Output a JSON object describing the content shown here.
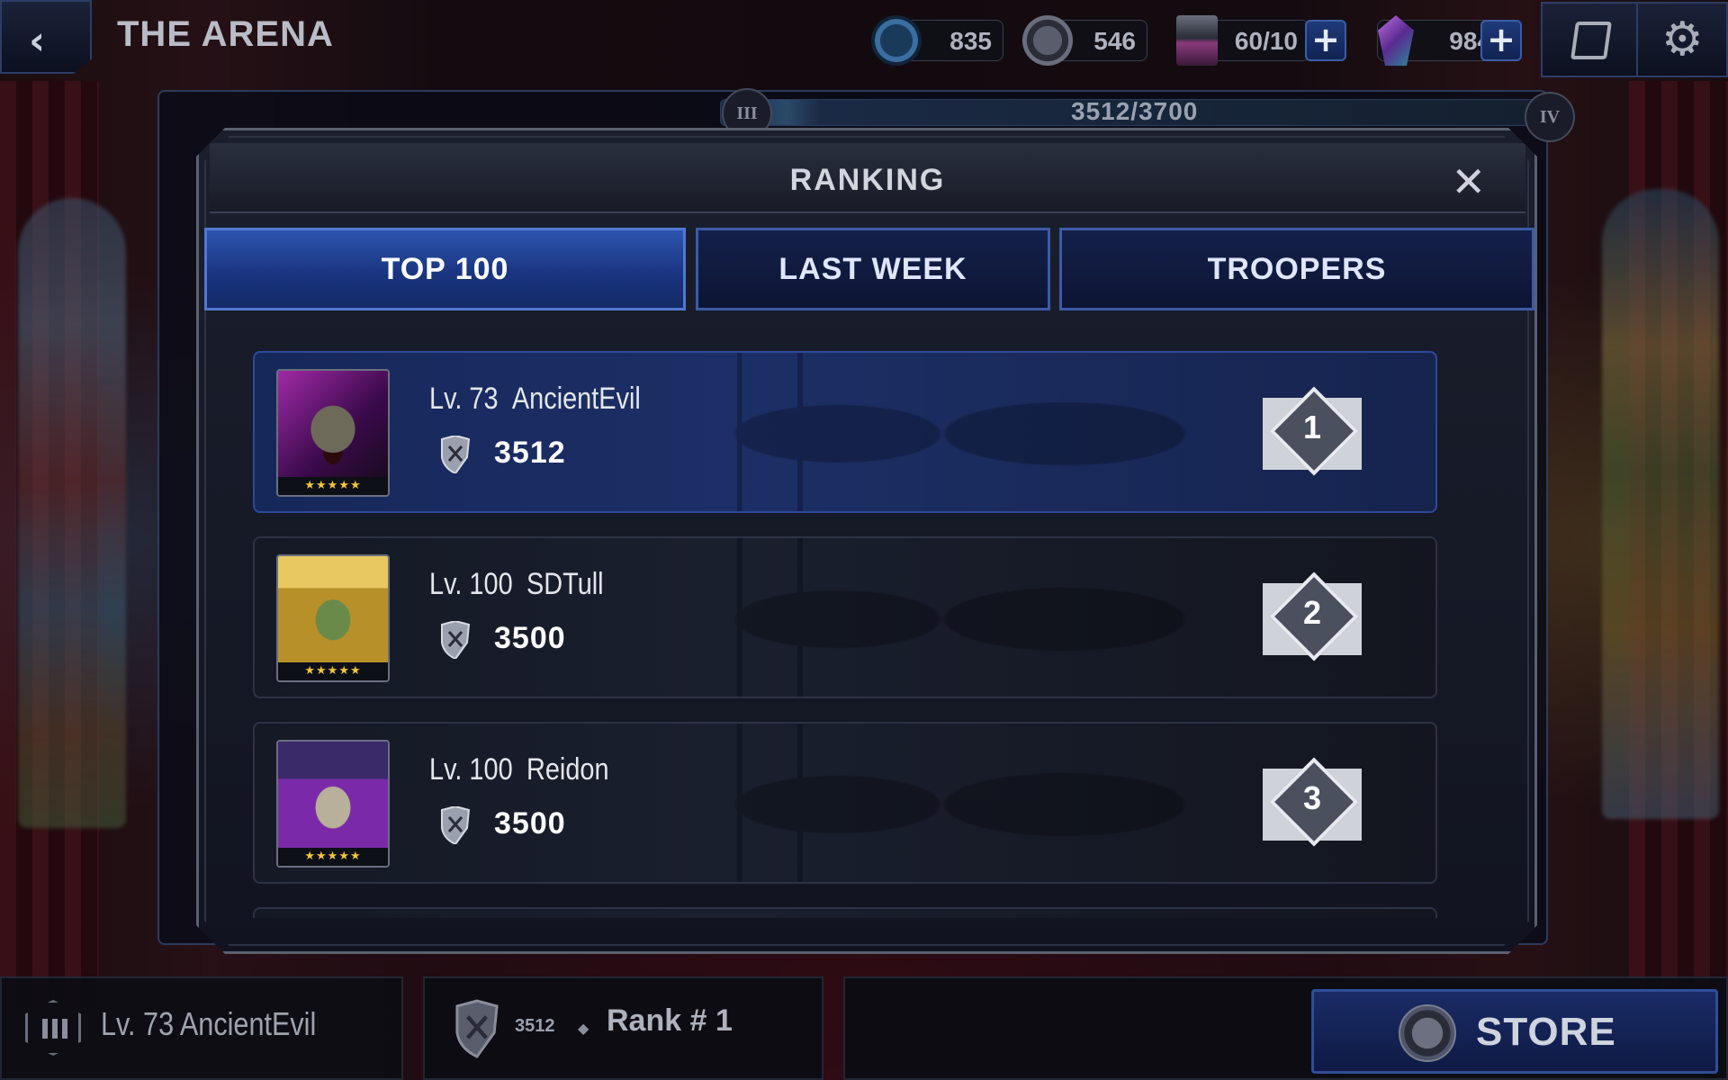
{
  "header": {
    "title": "THE ARENA",
    "resources": [
      {
        "name": "arena-token",
        "value": "835"
      },
      {
        "name": "trooper-coin",
        "value": "546"
      },
      {
        "name": "stamina",
        "value": "60/10"
      },
      {
        "name": "crystals",
        "value": "984"
      }
    ]
  },
  "background": {
    "progress_text": "3512/3700",
    "badge_left": "III",
    "badge_right": "IV"
  },
  "modal": {
    "title": "RANKING",
    "close_glyph": "✕",
    "tabs": [
      {
        "label": "TOP 100",
        "active": true
      },
      {
        "label": "LAST WEEK",
        "active": false
      },
      {
        "label": "TROOPERS",
        "active": false
      }
    ],
    "rows": [
      {
        "level": "Lv. 73",
        "name": "AncientEvil",
        "score": "3512",
        "rank": "1",
        "stars": "★★★★★",
        "portrait": "horned-demon",
        "highlight": true
      },
      {
        "level": "Lv. 100",
        "name": "SDTull",
        "score": "3500",
        "rank": "2",
        "stars": "★★★★★",
        "portrait": "gold-priest",
        "highlight": false
      },
      {
        "level": "Lv. 100",
        "name": "Reidon",
        "score": "3500",
        "rank": "3",
        "stars": "★★★★★",
        "portrait": "top-hat-skull",
        "highlight": false
      }
    ]
  },
  "footer": {
    "player": "Lv. 73  AncientEvil",
    "score": "3512",
    "separator": "◆",
    "rank": "Rank # 1",
    "store_label": "STORE"
  },
  "colors": {
    "accent_blue": "#2d55b0",
    "highlight_row": "#1c2f66",
    "star_gold": "#f3c53a"
  }
}
